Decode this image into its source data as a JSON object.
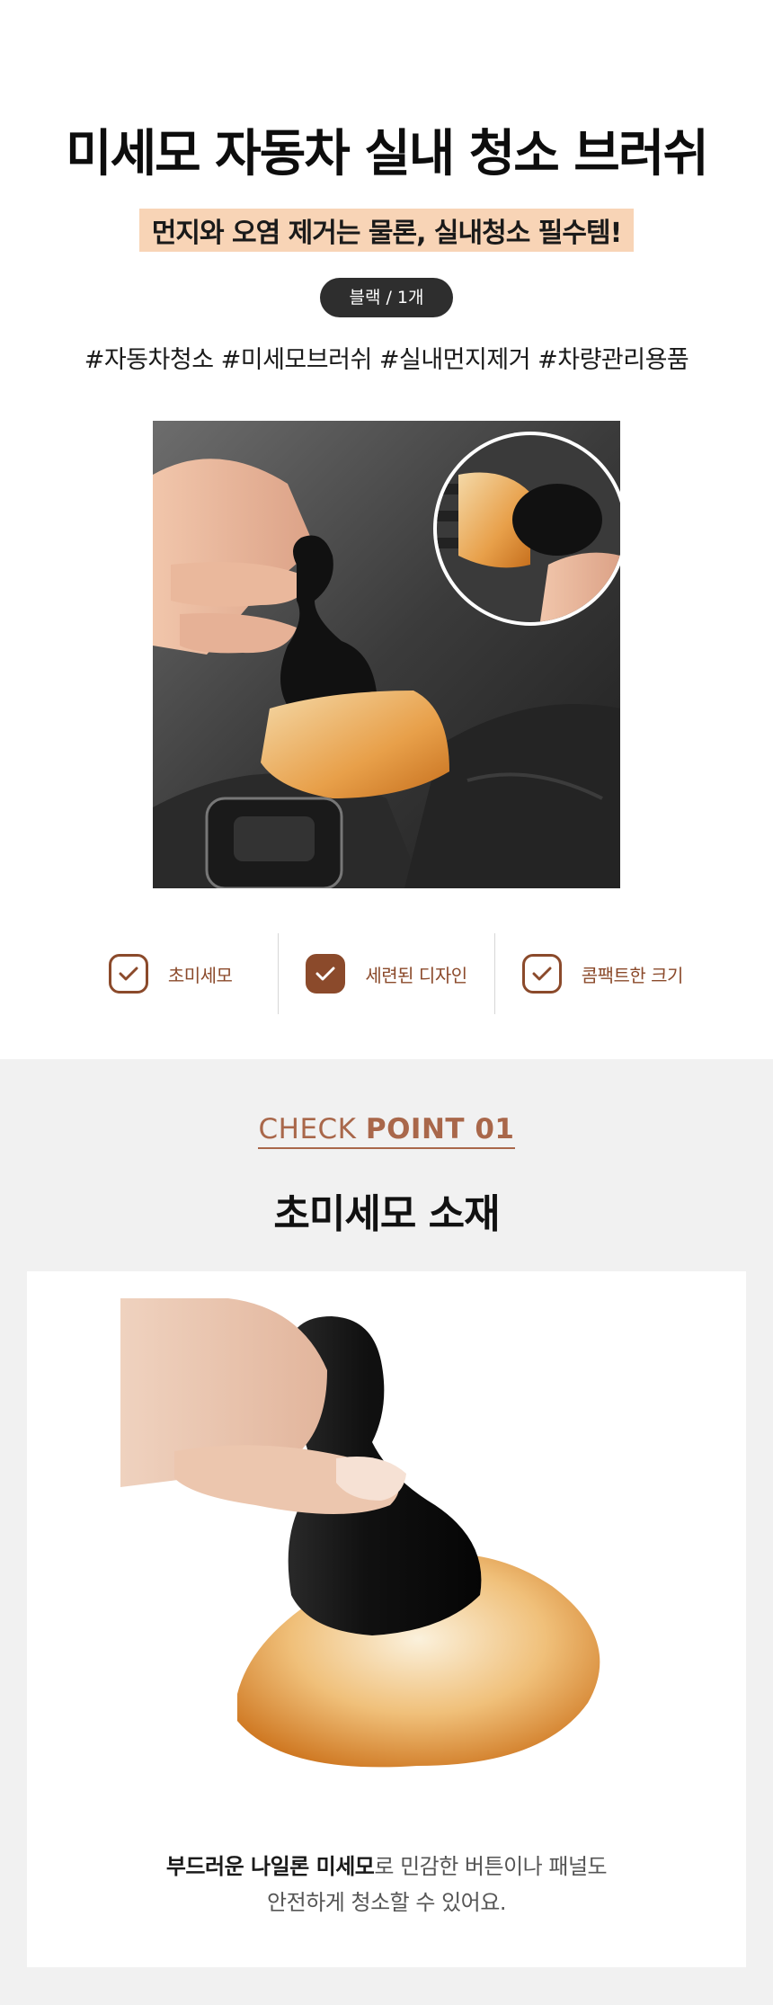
{
  "header": {
    "title": "미세모 자동차 실내 청소 브러쉬",
    "subtitle": "먼지와 오염 제거는 물론, 실내청소 필수템!",
    "option_chip": "블랙 /  1개",
    "hashtags": "#자동차청소 #미세모브러쉬 #실내먼지제거 #차량관리용품"
  },
  "features": [
    {
      "label": "초미세모",
      "filled": false
    },
    {
      "label": "세련된 디자인",
      "filled": true
    },
    {
      "label": "콤팩트한 크기",
      "filled": false
    }
  ],
  "checkpoint": {
    "prefix": "CHECK ",
    "number": "POINT 01",
    "title": "초미세모 소재",
    "caption_bold": "부드러운 나일론 미세모",
    "caption_rest": "로 민감한 버튼이나 패널도",
    "caption_line2": "안전하게 청소할 수 있어요."
  },
  "colors": {
    "accent": "#8b4a2b",
    "highlight": "#f8d4b6",
    "chip_bg": "#2e2e2e",
    "section_bg": "#f1f1f1"
  }
}
